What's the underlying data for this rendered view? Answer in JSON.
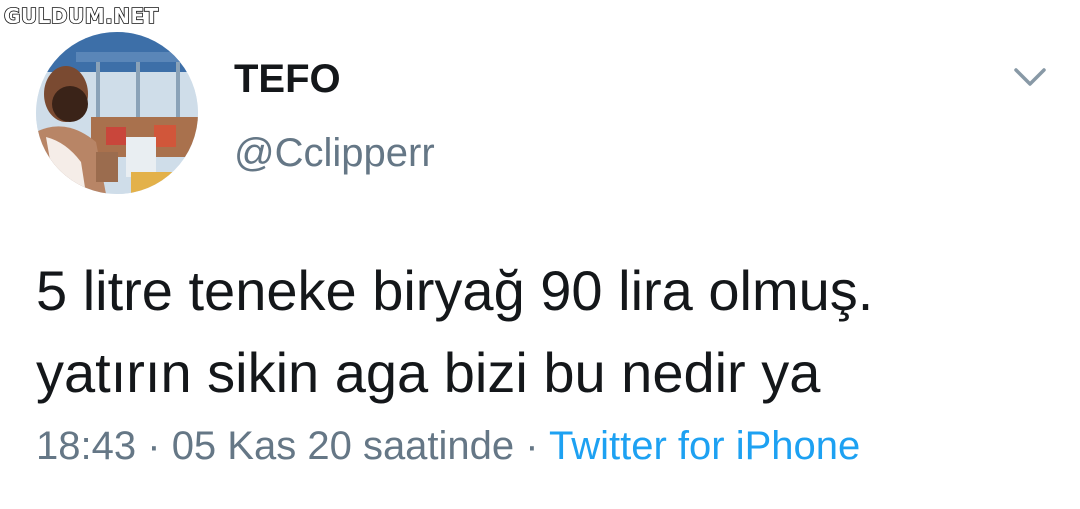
{
  "watermark": "GULDUM.NET",
  "tweet": {
    "display_name": "TEFO",
    "handle": "@Cclipperr",
    "text_lines": [
      "5 litre teneke biryağ 90 lira olmuş.",
      "yatırın sikin aga bizi bu nedir ya"
    ],
    "time": "18:43",
    "separator": "·",
    "date": "05 Kas 20 saatinde",
    "source": "Twitter for iPhone"
  },
  "icons": {
    "more": "chevron-down-icon",
    "avatar": "profile-photo"
  },
  "colors": {
    "name": "#14171a",
    "secondary": "#657786",
    "link": "#1da1f2",
    "background": "#ffffff"
  }
}
